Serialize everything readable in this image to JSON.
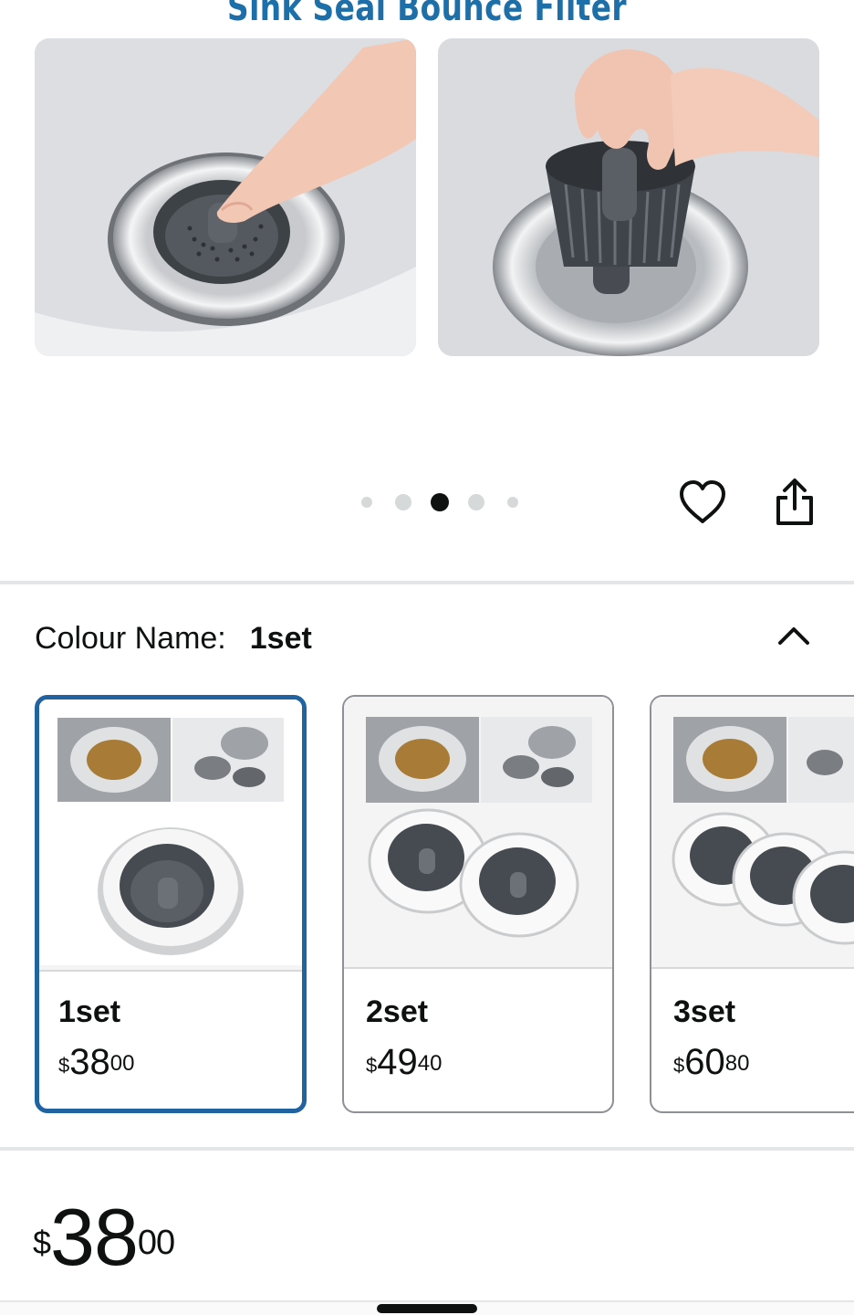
{
  "hero": {
    "banner_text": "Sink Seal Bounce Filter",
    "carousel_dot_count": 5,
    "active_dot_index": 2
  },
  "actions": {
    "heart_icon": "heart-outline-icon",
    "share_icon": "share-icon"
  },
  "variation": {
    "label": "Colour Name:",
    "selected_value": "1set",
    "collapse_icon": "chevron-up-icon",
    "options": [
      {
        "name": "1set",
        "currency": "$",
        "whole": "38",
        "fraction": "00",
        "selected": true
      },
      {
        "name": "2set",
        "currency": "$",
        "whole": "49",
        "fraction": "40",
        "selected": false
      },
      {
        "name": "3set",
        "currency": "$",
        "whole": "60",
        "fraction": "80",
        "selected": false
      }
    ]
  },
  "price": {
    "currency": "$",
    "whole": "38",
    "fraction": "00"
  },
  "colors": {
    "selected_border": "#2162a1",
    "banner_blue": "#1c6fa8",
    "text": "#0f1111"
  }
}
